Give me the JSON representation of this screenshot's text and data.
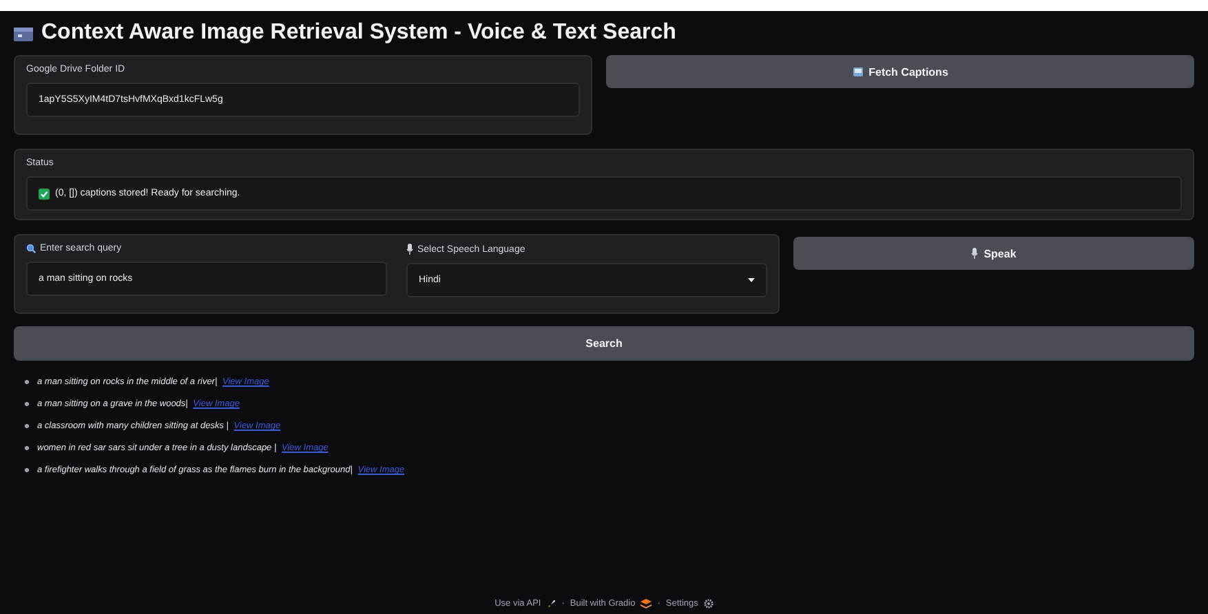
{
  "window": {
    "title": "Context Aware Image Retrieval System - Voice & Text Search"
  },
  "folder": {
    "label": "Google Drive Folder ID",
    "value": "1apY5S5XyIM4tD7tsHvfMXqBxd1kcFLw5g"
  },
  "fetch_button": {
    "label": "Fetch Captions"
  },
  "status": {
    "label": "Status",
    "checked": true,
    "text": "(0, []) captions stored! Ready for searching."
  },
  "query": {
    "label": "Enter search query",
    "value": "a man sitting on rocks"
  },
  "language": {
    "label": "Select Speech Language",
    "value": "Hindi"
  },
  "speak_button": {
    "label": "Speak"
  },
  "search_button": {
    "label": "Search"
  },
  "results": [
    {
      "caption": "a man sitting on rocks in the middle of a river|",
      "link": "View Image"
    },
    {
      "caption": "a man sitting on a grave in the woods|",
      "link": "View Image"
    },
    {
      "caption": "a classroom with many children sitting at desks |",
      "link": "View Image"
    },
    {
      "caption": "women in red sar sars sit under a tree in a dusty landscape |",
      "link": "View Image"
    },
    {
      "caption": "a firefighter walks through a field of grass as the flames burn in the background|",
      "link": "View Image"
    }
  ],
  "footer": [
    {
      "kind": "api",
      "label": "Use via API"
    },
    {
      "kind": "sep",
      "label": "·"
    },
    {
      "kind": "gradio",
      "label": "Built with Gradio"
    },
    {
      "kind": "sep",
      "label": "·"
    },
    {
      "kind": "settings",
      "label": "Settings"
    }
  ]
}
